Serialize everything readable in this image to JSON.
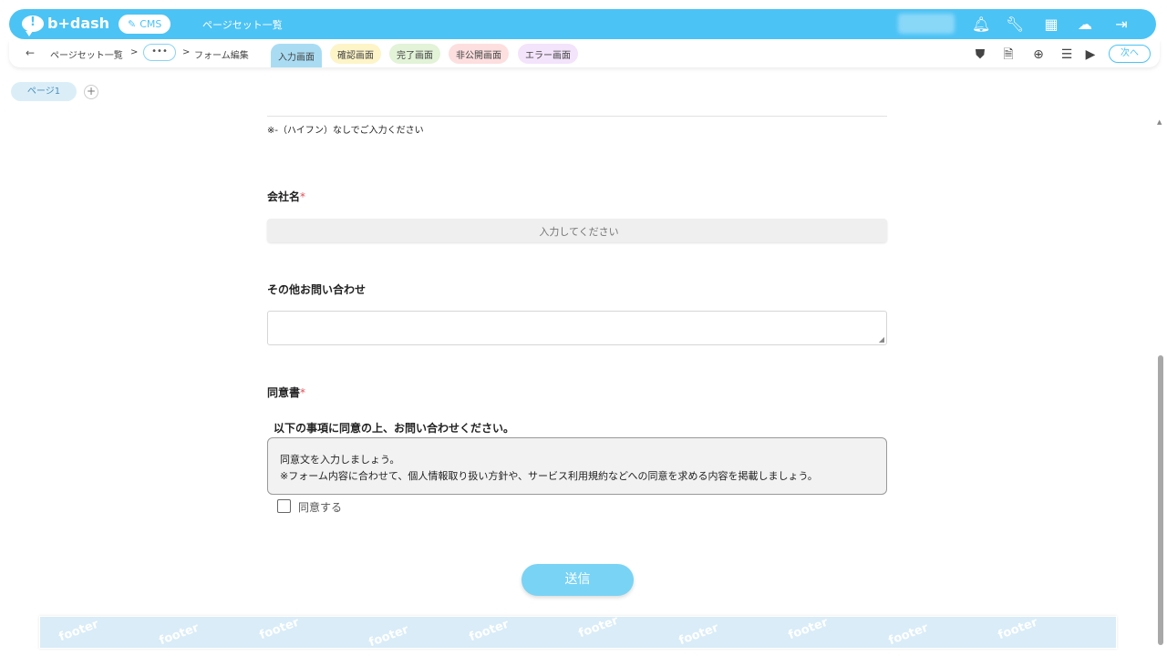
{
  "top_bar": {
    "logo_text": "b+dash",
    "cms_label": "CMS",
    "title": "ページセット一覧",
    "icons": [
      "bell-icon",
      "wrench-icon",
      "grid-icon",
      "ai-icon",
      "logout-icon"
    ]
  },
  "breadcrumb": {
    "items": [
      "ページセット一覧",
      "フォーム編集"
    ],
    "more": "•••",
    "separator": ">"
  },
  "tabs": [
    {
      "label": "入力画面",
      "color": "#a9dcf3"
    },
    {
      "label": "確認画面",
      "color": "#fdf4c8"
    },
    {
      "label": "完了画面",
      "color": "#e2f3d8"
    },
    {
      "label": "非公開画面",
      "color": "#fddfe0"
    },
    {
      "label": "エラー画面",
      "color": "#f3e3fb"
    }
  ],
  "toolbar": {
    "icons": [
      "shield-icon",
      "html-file-icon",
      "add-circle-icon",
      "list-settings-icon",
      "play-icon"
    ],
    "next_label": "次へ"
  },
  "pages": {
    "page1": "ページ1",
    "add": "+"
  },
  "form": {
    "phone_note": "※-（ハイフン）なしでご入力ください",
    "company_label": "会社名",
    "company_placeholder": "入力してください",
    "other_label": "その他お問い合わせ",
    "consent_label": "同意書",
    "required_mark": "*",
    "consent_title": "以下の事項に同意の上、お問い合わせください。",
    "consent_line1": "同意文を入力しましょう。",
    "consent_line2": "※フォーム内容に合わせて、個人情報取り扱い方針や、サービス利用規約などへの同意を求める内容を掲載しましょう。",
    "agree_label": "同意する",
    "submit_label": "送信"
  },
  "footer": {
    "watermark": "footer"
  }
}
